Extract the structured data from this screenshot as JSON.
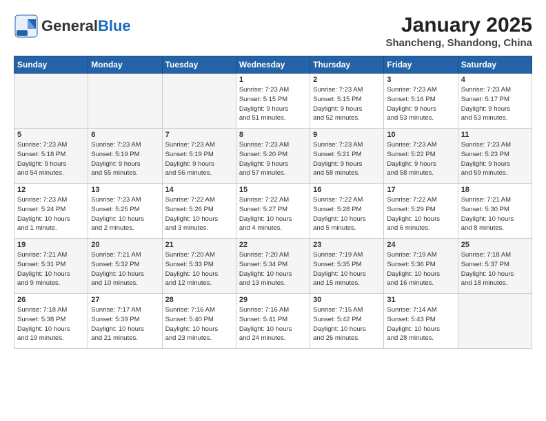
{
  "header": {
    "logo_general": "General",
    "logo_blue": "Blue",
    "month": "January 2025",
    "location": "Shancheng, Shandong, China"
  },
  "weekdays": [
    "Sunday",
    "Monday",
    "Tuesday",
    "Wednesday",
    "Thursday",
    "Friday",
    "Saturday"
  ],
  "weeks": [
    [
      {
        "day": "",
        "info": ""
      },
      {
        "day": "",
        "info": ""
      },
      {
        "day": "",
        "info": ""
      },
      {
        "day": "1",
        "info": "Sunrise: 7:23 AM\nSunset: 5:15 PM\nDaylight: 9 hours\nand 51 minutes."
      },
      {
        "day": "2",
        "info": "Sunrise: 7:23 AM\nSunset: 5:15 PM\nDaylight: 9 hours\nand 52 minutes."
      },
      {
        "day": "3",
        "info": "Sunrise: 7:23 AM\nSunset: 5:16 PM\nDaylight: 9 hours\nand 53 minutes."
      },
      {
        "day": "4",
        "info": "Sunrise: 7:23 AM\nSunset: 5:17 PM\nDaylight: 9 hours\nand 53 minutes."
      }
    ],
    [
      {
        "day": "5",
        "info": "Sunrise: 7:23 AM\nSunset: 5:18 PM\nDaylight: 9 hours\nand 54 minutes."
      },
      {
        "day": "6",
        "info": "Sunrise: 7:23 AM\nSunset: 5:19 PM\nDaylight: 9 hours\nand 55 minutes."
      },
      {
        "day": "7",
        "info": "Sunrise: 7:23 AM\nSunset: 5:19 PM\nDaylight: 9 hours\nand 56 minutes."
      },
      {
        "day": "8",
        "info": "Sunrise: 7:23 AM\nSunset: 5:20 PM\nDaylight: 9 hours\nand 57 minutes."
      },
      {
        "day": "9",
        "info": "Sunrise: 7:23 AM\nSunset: 5:21 PM\nDaylight: 9 hours\nand 58 minutes."
      },
      {
        "day": "10",
        "info": "Sunrise: 7:23 AM\nSunset: 5:22 PM\nDaylight: 9 hours\nand 58 minutes."
      },
      {
        "day": "11",
        "info": "Sunrise: 7:23 AM\nSunset: 5:23 PM\nDaylight: 9 hours\nand 59 minutes."
      }
    ],
    [
      {
        "day": "12",
        "info": "Sunrise: 7:23 AM\nSunset: 5:24 PM\nDaylight: 10 hours\nand 1 minute."
      },
      {
        "day": "13",
        "info": "Sunrise: 7:23 AM\nSunset: 5:25 PM\nDaylight: 10 hours\nand 2 minutes."
      },
      {
        "day": "14",
        "info": "Sunrise: 7:22 AM\nSunset: 5:26 PM\nDaylight: 10 hours\nand 3 minutes."
      },
      {
        "day": "15",
        "info": "Sunrise: 7:22 AM\nSunset: 5:27 PM\nDaylight: 10 hours\nand 4 minutes."
      },
      {
        "day": "16",
        "info": "Sunrise: 7:22 AM\nSunset: 5:28 PM\nDaylight: 10 hours\nand 5 minutes."
      },
      {
        "day": "17",
        "info": "Sunrise: 7:22 AM\nSunset: 5:29 PM\nDaylight: 10 hours\nand 6 minutes."
      },
      {
        "day": "18",
        "info": "Sunrise: 7:21 AM\nSunset: 5:30 PM\nDaylight: 10 hours\nand 8 minutes."
      }
    ],
    [
      {
        "day": "19",
        "info": "Sunrise: 7:21 AM\nSunset: 5:31 PM\nDaylight: 10 hours\nand 9 minutes."
      },
      {
        "day": "20",
        "info": "Sunrise: 7:21 AM\nSunset: 5:32 PM\nDaylight: 10 hours\nand 10 minutes."
      },
      {
        "day": "21",
        "info": "Sunrise: 7:20 AM\nSunset: 5:33 PM\nDaylight: 10 hours\nand 12 minutes."
      },
      {
        "day": "22",
        "info": "Sunrise: 7:20 AM\nSunset: 5:34 PM\nDaylight: 10 hours\nand 13 minutes."
      },
      {
        "day": "23",
        "info": "Sunrise: 7:19 AM\nSunset: 5:35 PM\nDaylight: 10 hours\nand 15 minutes."
      },
      {
        "day": "24",
        "info": "Sunrise: 7:19 AM\nSunset: 5:36 PM\nDaylight: 10 hours\nand 16 minutes."
      },
      {
        "day": "25",
        "info": "Sunrise: 7:18 AM\nSunset: 5:37 PM\nDaylight: 10 hours\nand 18 minutes."
      }
    ],
    [
      {
        "day": "26",
        "info": "Sunrise: 7:18 AM\nSunset: 5:38 PM\nDaylight: 10 hours\nand 19 minutes."
      },
      {
        "day": "27",
        "info": "Sunrise: 7:17 AM\nSunset: 5:39 PM\nDaylight: 10 hours\nand 21 minutes."
      },
      {
        "day": "28",
        "info": "Sunrise: 7:16 AM\nSunset: 5:40 PM\nDaylight: 10 hours\nand 23 minutes."
      },
      {
        "day": "29",
        "info": "Sunrise: 7:16 AM\nSunset: 5:41 PM\nDaylight: 10 hours\nand 24 minutes."
      },
      {
        "day": "30",
        "info": "Sunrise: 7:15 AM\nSunset: 5:42 PM\nDaylight: 10 hours\nand 26 minutes."
      },
      {
        "day": "31",
        "info": "Sunrise: 7:14 AM\nSunset: 5:43 PM\nDaylight: 10 hours\nand 28 minutes."
      },
      {
        "day": "",
        "info": ""
      }
    ]
  ]
}
